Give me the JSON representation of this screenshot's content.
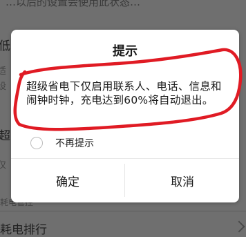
{
  "background": {
    "top_fragment": "…以后的设置会使用此状态…",
    "char_1": "低",
    "char_2": "适",
    "char_3": "设",
    "char_4": "超",
    "char_5": "仅",
    "manage_label": "耗电管控",
    "rank_label": "耗电排行"
  },
  "dialog": {
    "title": "提示",
    "message": "超级省电下仅启用联系人、电话、信息和闹钟时钟，充电达到60%将自动退出。",
    "dont_remind_label": "不再提示",
    "confirm_label": "确定",
    "cancel_label": "取消"
  },
  "colors": {
    "overlay": "#6f6f6f",
    "dialog_bg": "#ffffff",
    "annotation": "#e01b24"
  }
}
